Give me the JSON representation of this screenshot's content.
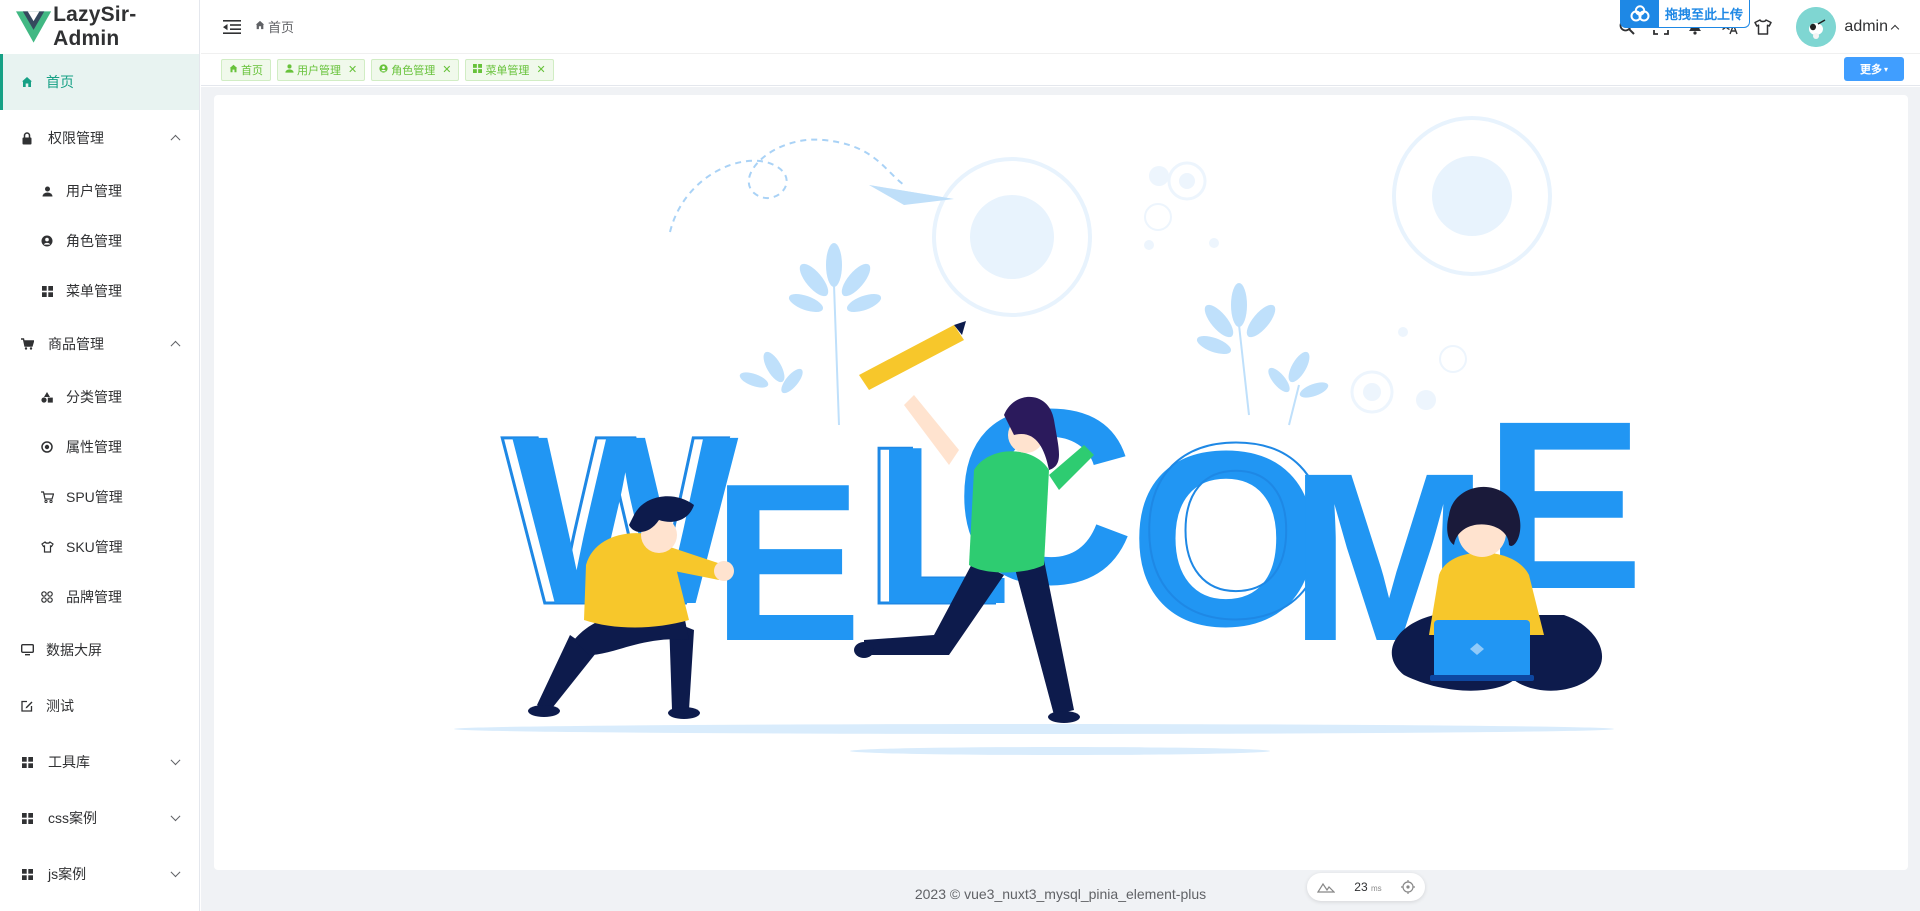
{
  "app": {
    "title": "LazySir-Admin"
  },
  "sidebar": {
    "items": [
      {
        "label": "首页",
        "icon": "home-icon",
        "active": true
      },
      {
        "label": "权限管理",
        "icon": "lock-icon",
        "expanded": true
      },
      {
        "label": "用户管理",
        "icon": "user-icon"
      },
      {
        "label": "角色管理",
        "icon": "role-icon"
      },
      {
        "label": "菜单管理",
        "icon": "menu-grid-icon"
      },
      {
        "label": "商品管理",
        "icon": "cart-icon",
        "expanded": true
      },
      {
        "label": "分类管理",
        "icon": "category-icon"
      },
      {
        "label": "属性管理",
        "icon": "attribute-icon"
      },
      {
        "label": "SPU管理",
        "icon": "spu-icon"
      },
      {
        "label": "SKU管理",
        "icon": "sku-icon"
      },
      {
        "label": "品牌管理",
        "icon": "brand-icon"
      },
      {
        "label": "数据大屏",
        "icon": "monitor-icon"
      },
      {
        "label": "测试",
        "icon": "edit-icon"
      },
      {
        "label": "工具库",
        "icon": "grid-icon",
        "expanded": false
      },
      {
        "label": "css案例",
        "icon": "grid-icon",
        "expanded": false
      },
      {
        "label": "js案例",
        "icon": "grid-icon",
        "expanded": false
      }
    ]
  },
  "header": {
    "breadcrumb": "首页",
    "upload_label": "拖拽至此上传",
    "username": "admin"
  },
  "tags": [
    {
      "label": "首页",
      "closable": false
    },
    {
      "label": "用户管理",
      "closable": true
    },
    {
      "label": "角色管理",
      "closable": true
    },
    {
      "label": "菜单管理",
      "closable": true
    }
  ],
  "more_label": "更多",
  "footer": {
    "text": "2023 © vue3_nuxt3_mysql_pinia_element-plus"
  },
  "perf": {
    "value": "23",
    "unit": "ms"
  },
  "welcome": {
    "letters": [
      "W",
      "E",
      "L",
      "C",
      "O",
      "M",
      "E"
    ]
  },
  "colors": {
    "accent": "#16a085",
    "brand_blue": "#2196f3",
    "tag_green": "#67c23a",
    "button_blue": "#409eff"
  }
}
